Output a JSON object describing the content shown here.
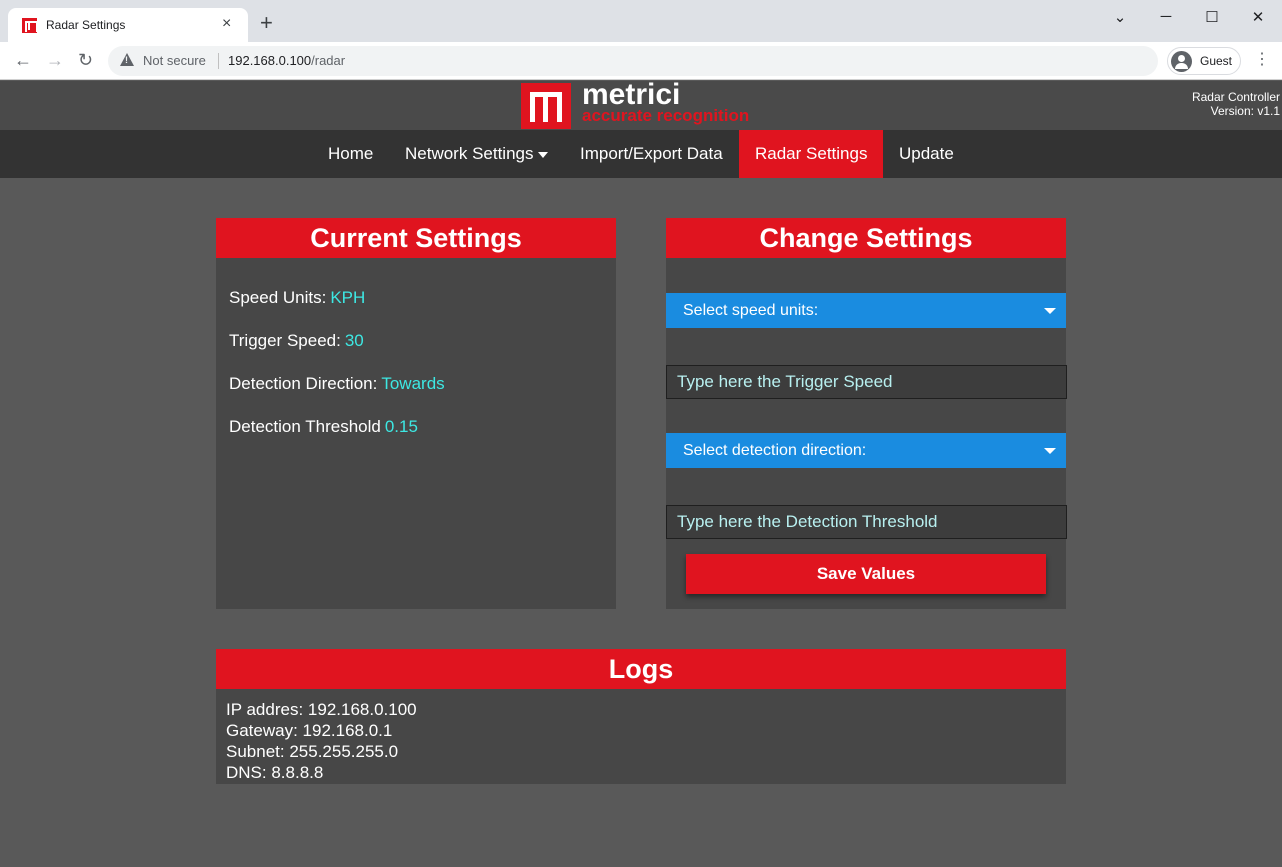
{
  "browser": {
    "tab_title": "Radar Settings",
    "tab_close": "×",
    "new_tab": "+",
    "minimize": "─",
    "maximize": "☐",
    "close": "✕",
    "chevron": "⌄",
    "back": "←",
    "forward": "→",
    "reload": "↻",
    "not_secure": "Not secure",
    "url_host": "192.168.0.100",
    "url_path": "/radar",
    "profile": "Guest",
    "menu": "⋮"
  },
  "header": {
    "logo_word": "metrici",
    "logo_tagline": "accurate recognition",
    "controller_name": "Radar Controller",
    "version": "Version: v1.1"
  },
  "nav": {
    "items": [
      {
        "label": "Home"
      },
      {
        "label": "Network Settings"
      },
      {
        "label": "Import/Export Data"
      },
      {
        "label": "Radar Settings"
      },
      {
        "label": "Update"
      }
    ],
    "active_index": 3
  },
  "current_settings": {
    "title": "Current Settings",
    "rows": [
      {
        "label": "Speed Units:",
        "value": "KPH"
      },
      {
        "label": "Trigger Speed:",
        "value": "30"
      },
      {
        "label": "Detection Direction:",
        "value": "Towards"
      },
      {
        "label": "Detection Threshold",
        "value": "0.15"
      }
    ]
  },
  "change_settings": {
    "title": "Change Settings",
    "speed_units_select": "Select speed units:",
    "trigger_speed_placeholder": "Type here the Trigger Speed",
    "direction_select": "Select detection direction:",
    "threshold_placeholder": "Type here the Detection Threshold",
    "save_label": "Save Values"
  },
  "logs": {
    "title": "Logs",
    "lines": [
      "IP addres: 192.168.0.100",
      "Gateway: 192.168.0.1",
      "Subnet: 255.255.255.0",
      "DNS: 8.8.8.8"
    ]
  },
  "colors": {
    "accent_red": "#e0141f",
    "value_cyan": "#3de8e3",
    "select_blue": "#1a8ce0",
    "page_bg": "#595959"
  }
}
